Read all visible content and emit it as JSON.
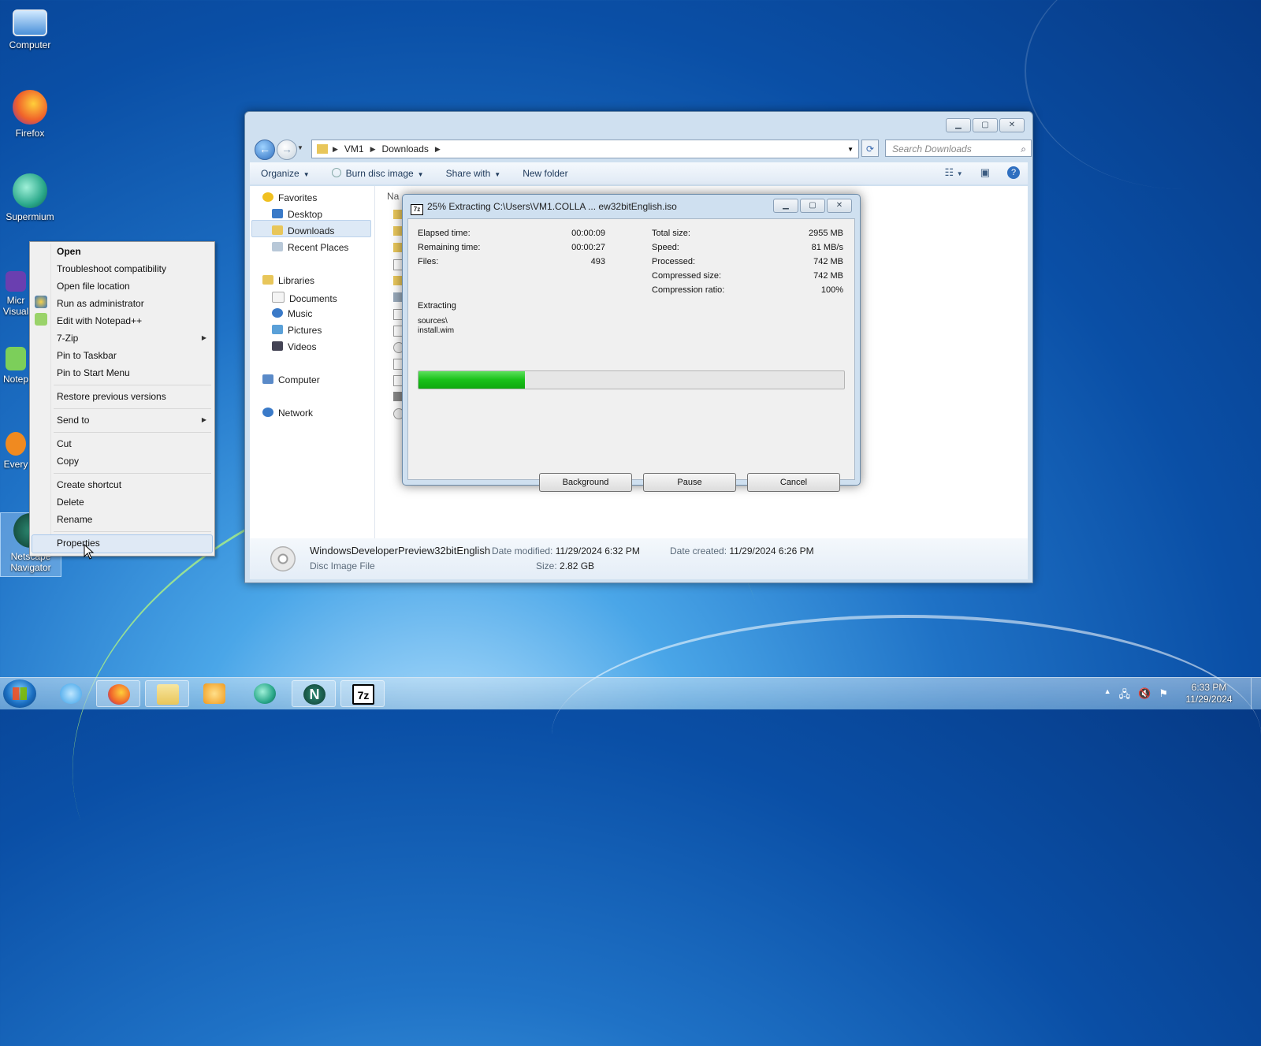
{
  "desktop": {
    "icons": [
      {
        "label": "Computer"
      },
      {
        "label": "Firefox"
      },
      {
        "label": "Supermium"
      },
      {
        "label": "Micr\nVisual"
      },
      {
        "label": "Notep"
      },
      {
        "label": "Every"
      },
      {
        "label": "Netscape\nNavigator"
      }
    ]
  },
  "context_menu": {
    "items": [
      {
        "label": "Open"
      },
      {
        "label": "Troubleshoot compatibility"
      },
      {
        "label": "Open file location"
      },
      {
        "label": "Run as administrator"
      },
      {
        "label": "Edit with Notepad++"
      },
      {
        "label": "7-Zip"
      },
      {
        "label": "Pin to Taskbar"
      },
      {
        "label": "Pin to Start Menu"
      },
      {
        "label": "Restore previous versions"
      },
      {
        "label": "Send to"
      },
      {
        "label": "Cut"
      },
      {
        "label": "Copy"
      },
      {
        "label": "Create shortcut"
      },
      {
        "label": "Delete"
      },
      {
        "label": "Rename"
      },
      {
        "label": "Properties"
      }
    ]
  },
  "explorer": {
    "breadcrumb": [
      "VM1",
      "Downloads"
    ],
    "search_placeholder": "Search Downloads",
    "toolbar": {
      "organize": "Organize",
      "burn": "Burn disc image",
      "share": "Share with",
      "new_folder": "New folder"
    },
    "nav": {
      "favorites": "Favorites",
      "desktop": "Desktop",
      "downloads": "Downloads",
      "recent": "Recent Places",
      "libraries": "Libraries",
      "documents": "Documents",
      "music": "Music",
      "pictures": "Pictures",
      "videos": "Videos",
      "computer": "Computer",
      "network": "Network"
    },
    "file_col_header": "Na",
    "details": {
      "name": "WindowsDeveloperPreview32bitEnglish",
      "type": "Disc Image File",
      "modified_label": "Date modified:",
      "modified": "11/29/2024 6:32 PM",
      "created_label": "Date created:",
      "created": "11/29/2024 6:26 PM",
      "size_label": "Size:",
      "size": "2.82 GB"
    }
  },
  "dialog": {
    "title": "25% Extracting C:\\Users\\VM1.COLLA ... ew32bitEnglish.iso",
    "app_badge": "7z",
    "left_stats": [
      {
        "label": "Elapsed time:",
        "value": "00:00:09"
      },
      {
        "label": "Remaining time:",
        "value": "00:00:27"
      },
      {
        "label": "Files:",
        "value": "493"
      }
    ],
    "right_stats": [
      {
        "label": "Total size:",
        "value": "2955 MB"
      },
      {
        "label": "Speed:",
        "value": "81 MB/s"
      },
      {
        "label": "Processed:",
        "value": "742 MB"
      },
      {
        "label": "Compressed size:",
        "value": "742 MB"
      },
      {
        "label": "Compression ratio:",
        "value": "100%"
      }
    ],
    "status": "Extracting",
    "path_line1": "sources\\",
    "path_line2": "install.wim",
    "progress_fraction": 0.25,
    "buttons": {
      "background": "Background",
      "pause": "Pause",
      "cancel": "Cancel"
    }
  },
  "taskbar": {
    "apps": [
      {
        "name": "internet-explorer-icon",
        "color": "#3aa0e8"
      },
      {
        "name": "firefox-icon",
        "color": "#f0622a"
      },
      {
        "name": "file-explorer-icon",
        "color": "#e8c65a"
      },
      {
        "name": "media-player-icon",
        "color": "#f09a20"
      },
      {
        "name": "supermium-icon",
        "color": "#2aa88a"
      },
      {
        "name": "netscape-icon",
        "color": "#1b6f5a"
      },
      {
        "name": "7zip-icon",
        "color": "#000000"
      }
    ],
    "time": "6:33 PM",
    "date": "11/29/2024"
  }
}
